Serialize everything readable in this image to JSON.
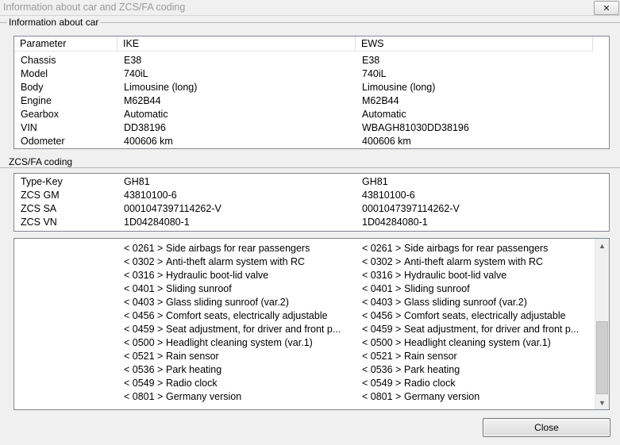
{
  "window": {
    "title": "Information about car and ZCS/FA coding",
    "close_glyph": "✕"
  },
  "car_group": {
    "label": "Information about car"
  },
  "car_table": {
    "headers": [
      "Parameter",
      "IKE",
      "EWS"
    ],
    "rows": [
      [
        "Chassis",
        "E38",
        "E38"
      ],
      [
        "Model",
        "740iL",
        "740iL"
      ],
      [
        "Body",
        "Limousine (long)",
        "Limousine (long)"
      ],
      [
        "Engine",
        "M62B44",
        "M62B44"
      ],
      [
        "Gearbox",
        "Automatic",
        "Automatic"
      ],
      [
        "VIN",
        "DD38196",
        "WBAGH81030DD38196"
      ],
      [
        "Odometer",
        "400606 km",
        "400606 km"
      ]
    ]
  },
  "zcs_group": {
    "label": "ZCS/FA coding"
  },
  "zcs_table": {
    "rows": [
      [
        "Type-Key",
        "GH81",
        "GH81"
      ],
      [
        "ZCS GM",
        "43810100-6",
        "43810100-6"
      ],
      [
        "ZCS SA",
        "0001047397114262-V",
        "0001047397114262-V"
      ],
      [
        "ZCS VN",
        "1D04284080-1",
        "1D04284080-1"
      ]
    ]
  },
  "options": {
    "ike": [
      [
        "< 0261 >",
        "Side airbags for rear passengers"
      ],
      [
        "< 0302 >",
        "Anti-theft alarm system with RC"
      ],
      [
        "< 0316 >",
        "Hydraulic boot-lid valve"
      ],
      [
        "< 0401 >",
        "Sliding sunroof"
      ],
      [
        "< 0403 >",
        "Glass sliding sunroof (var.2)"
      ],
      [
        "< 0456 >",
        "Comfort seats, electrically adjustable"
      ],
      [
        "< 0459 >",
        "Seat adjustment, for driver and front p..."
      ],
      [
        "< 0500 >",
        "Headlight cleaning system (var.1)"
      ],
      [
        "< 0521 >",
        "Rain sensor"
      ],
      [
        "< 0536 >",
        "Park heating"
      ],
      [
        "< 0549 >",
        "Radio clock"
      ],
      [
        "< 0801 >",
        "Germany version"
      ]
    ],
    "ews": [
      [
        "< 0261 >",
        "Side airbags for rear passengers"
      ],
      [
        "< 0302 >",
        "Anti-theft alarm system with RC"
      ],
      [
        "< 0316 >",
        "Hydraulic boot-lid valve"
      ],
      [
        "< 0401 >",
        "Sliding sunroof"
      ],
      [
        "< 0403 >",
        "Glass sliding sunroof (var.2)"
      ],
      [
        "< 0456 >",
        "Comfort seats, electrically adjustable"
      ],
      [
        "< 0459 >",
        "Seat adjustment, for driver and front p..."
      ],
      [
        "< 0500 >",
        "Headlight cleaning system (var.1)"
      ],
      [
        "< 0521 >",
        "Rain sensor"
      ],
      [
        "< 0536 >",
        "Park heating"
      ],
      [
        "< 0549 >",
        "Radio clock"
      ],
      [
        "< 0801 >",
        "Germany version"
      ]
    ],
    "scroll_up_glyph": "▲",
    "scroll_down_glyph": "▼"
  },
  "buttons": {
    "close_label": "Close"
  }
}
